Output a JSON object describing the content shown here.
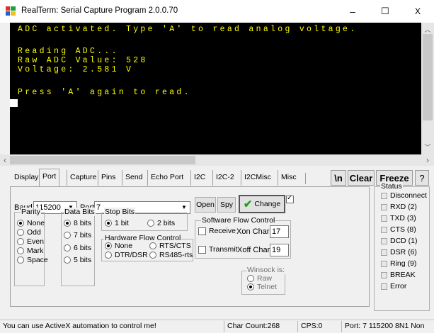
{
  "window": {
    "title": "RealTerm: Serial Capture Program 2.0.0.70",
    "minimize": "–",
    "maximize": "☐",
    "close": "X"
  },
  "terminal": {
    "lines": [
      "ADC activated. Type 'A' to read analog voltage.",
      "Reading ADC...",
      "Raw ADC Value: 528",
      "Voltage: 2.581 V",
      "Press 'A' again to read."
    ],
    "text_color": "#ffff00",
    "background": "#000000"
  },
  "tabs": [
    "Display",
    "Port",
    "Capture",
    "Pins",
    "Send",
    "Echo Port",
    "I2C",
    "I2C-2",
    "I2CMisc",
    "Misc"
  ],
  "active_tab": "Port",
  "toolbar": {
    "newline_label": "\\n",
    "clear_label": "Clear",
    "freeze_label": "Freeze",
    "help_label": "?"
  },
  "port": {
    "baud_label": "Baud",
    "baud_value": "115200",
    "port_label": "Port",
    "port_value": "7",
    "open_label": "Open",
    "spy_label": "Spy",
    "change_label": "Change",
    "parity": {
      "title": "Parity",
      "options": [
        "None",
        "Odd",
        "Even",
        "Mark",
        "Space"
      ],
      "selected": "None"
    },
    "data_bits": {
      "title": "Data Bits",
      "options": [
        "8 bits",
        "7 bits",
        "6 bits",
        "5 bits"
      ],
      "selected": "8 bits"
    },
    "stop_bits": {
      "title": "Stop Bits",
      "options": [
        "1 bit",
        "2 bits"
      ],
      "selected": "1 bit"
    },
    "hw_flow": {
      "title": "Hardware Flow Control",
      "options": [
        "None",
        "RTS/CTS",
        "DTR/DSR",
        "RS485-rts"
      ],
      "selected": "None"
    },
    "sw_flow": {
      "title": "Software Flow Control",
      "receive_label": "Receive",
      "xon_label": "Xon Char:",
      "xon_value": "17",
      "transmit_label": "Transmit",
      "xoff_label": "Xoff Char:",
      "xoff_value": "19"
    },
    "winsock": {
      "title": "Winsock is:",
      "options": [
        "Raw",
        "Telnet"
      ],
      "selected": "Telnet"
    }
  },
  "status": {
    "title": "Status",
    "items": [
      "Disconnect",
      "RXD (2)",
      "TXD (3)",
      "CTS (8)",
      "DCD (1)",
      "DSR (6)",
      "Ring (9)",
      "BREAK",
      "Error"
    ]
  },
  "statusbar": {
    "message": "You can use ActiveX automation to control me!",
    "char_count": "Char Count:268",
    "cps": "CPS:0",
    "port_info": "Port: 7 115200 8N1 Non"
  }
}
